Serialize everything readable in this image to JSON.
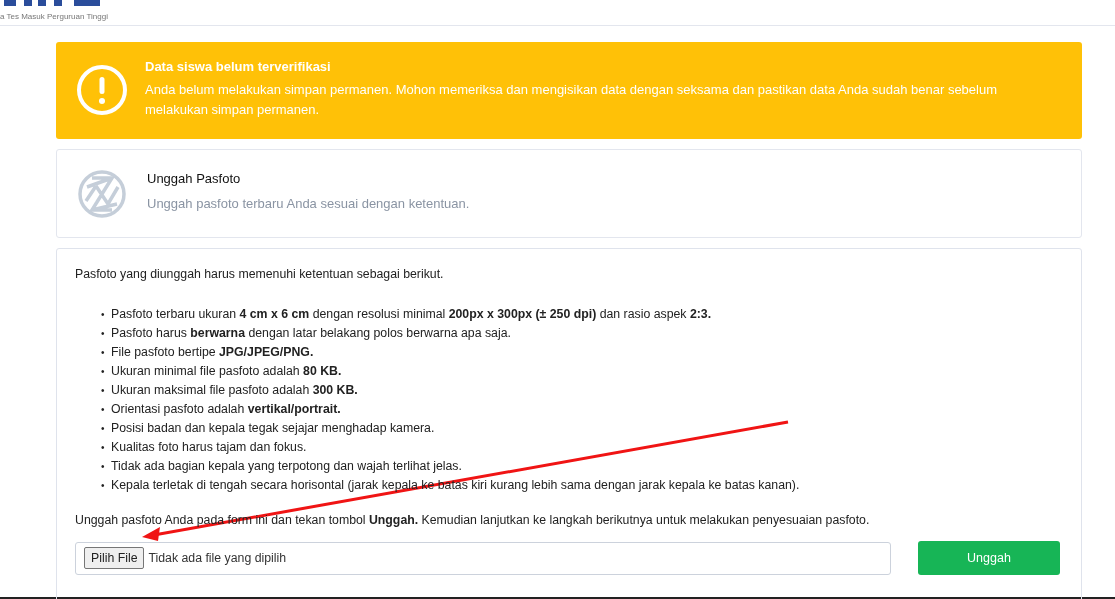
{
  "header": {
    "tagline": "a Tes Masuk Perguruan Tinggi"
  },
  "alert": {
    "kind": "warning",
    "title": "Data siswa belum terverifikasi",
    "message": "Anda belum melakukan simpan permanen. Mohon memeriksa dan mengisikan data dengan seksama dan pastikan data Anda sudah benar sebelum melakukan simpan permanen."
  },
  "upload_card": {
    "title": "Unggah Pasfoto",
    "subtitle": "Unggah pasfoto terbaru Anda sesuai dengan ketentuan."
  },
  "requirements": {
    "intro": "Pasfoto yang diunggah harus memenuhi ketentuan sebagai berikut.",
    "items": [
      {
        "marker": "•",
        "text": "Pasfoto terbaru ukuran **4 cm x 6 cm** dengan resolusi minimal **200px x 300px (± 250 dpi)** dan rasio aspek **2:3.**"
      },
      {
        "marker": "•",
        "text": "Pasfoto harus **berwarna** dengan latar belakang polos berwarna apa saja."
      },
      {
        "marker": "•",
        "text": "File pasfoto bertipe **JPG/JPEG/PNG.**"
      },
      {
        "marker": "•",
        "text": "Ukuran minimal file pasfoto adalah **80 KB.**"
      },
      {
        "marker": "•",
        "text": "Ukuran maksimal file pasfoto adalah **300 KB.**"
      },
      {
        "marker": "•",
        "text": "Orientasi pasfoto adalah **vertikal/portrait.**"
      },
      {
        "marker": "•",
        "text": "Posisi badan dan kepala tegak sejajar menghadap kamera."
      },
      {
        "marker": "•",
        "text": "Kualitas foto harus tajam dan fokus."
      },
      {
        "marker": "•",
        "text": "Tidak ada bagian kepala yang terpotong dan wajah terlihat jelas."
      },
      {
        "marker": "•",
        "text": "Kepala terletak di tengah secara horisontal (jarak kepala ke batas kiri kurang lebih sama dengan jarak kepala ke batas kanan)."
      }
    ],
    "instruction": "Unggah pasfoto Anda pada form ini dan tekan tombol **Unggah.** Kemudian lanjutkan ke langkah berikutnya untuk melakukan penyesuaian pasfoto."
  },
  "file_input": {
    "button": "Pilih File",
    "status": "Tidak ada file yang dipilih"
  },
  "submit_button": "Unggah"
}
